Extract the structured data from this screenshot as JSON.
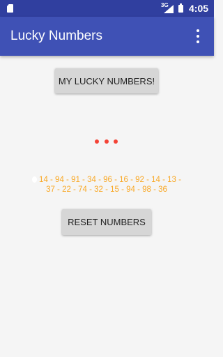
{
  "status_bar": {
    "network_label": "3G",
    "time": "4:05",
    "icons": [
      "sd-card-icon",
      "signal-icon",
      "battery-icon"
    ]
  },
  "app_bar": {
    "title": "Lucky Numbers",
    "menu_icon": "overflow-menu-icon"
  },
  "main": {
    "lucky_button_label": "MY LUCKY NUMBERS!",
    "numbers_line_1": "14 - 94 - 91 - 34 - 96 - 16 - 92 - 14 - 13 -",
    "numbers_line_2": "37 - 22 - 74 - 32 - 15 - 94 - 98 - 36",
    "reset_button_label": "RESET NUMBERS"
  },
  "colors": {
    "status_bar": "#303f9f",
    "app_bar": "#3f51b5",
    "background": "#f5f5f5",
    "button": "#d6d6d6",
    "loader_dots": "#f44336",
    "numbers_text": "#f9a825"
  }
}
